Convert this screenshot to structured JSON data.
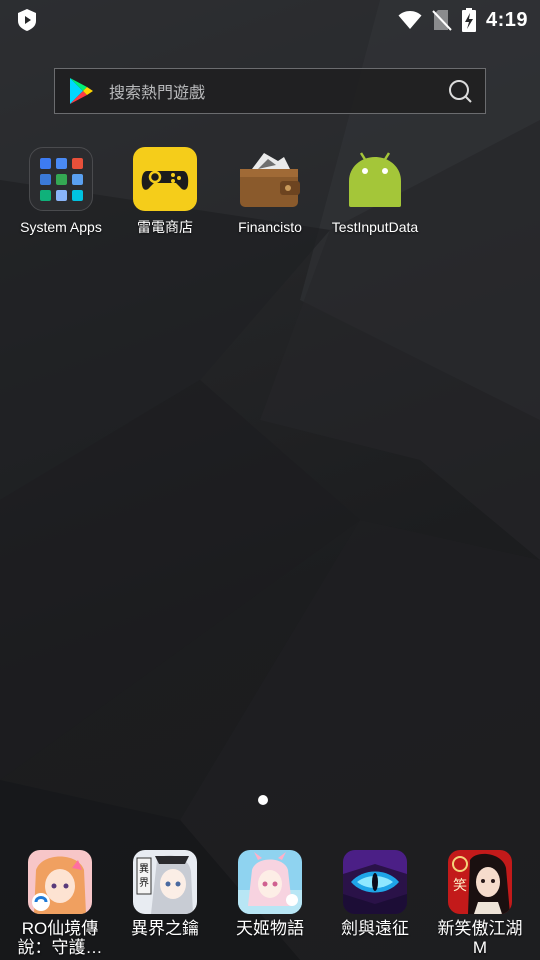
{
  "status_bar": {
    "time": "4:19",
    "left_icon": "shield-play-icon",
    "icons": [
      "wifi-icon",
      "no-sim-icon",
      "battery-charging-icon"
    ]
  },
  "search": {
    "placeholder": "搜索熱門遊戲",
    "logo": "google-play-icon",
    "button_icon": "search-icon"
  },
  "apps": [
    {
      "label": "System Apps",
      "icon": "folder-icon"
    },
    {
      "label": "雷電商店",
      "icon": "gamepad-store-icon"
    },
    {
      "label": "Financisto",
      "icon": "wallet-icon"
    },
    {
      "label": "TestInputData",
      "icon": "android-icon"
    }
  ],
  "page_indicator": {
    "pages": 1,
    "current": 1
  },
  "dock": [
    {
      "label_line1": "RO仙境傳",
      "label_line2": "說：守護…",
      "icon": "ro-game-icon"
    },
    {
      "label_line1": "異界之鑰",
      "label_line2": "",
      "icon": "anime-girl-icon"
    },
    {
      "label_line1": "天姬物語",
      "label_line2": "",
      "icon": "fantasy-girl-icon"
    },
    {
      "label_line1": "劍與遠征",
      "label_line2": "",
      "icon": "dragon-eye-icon"
    },
    {
      "label_line1": "新笑傲江湖",
      "label_line2": "M",
      "icon": "wuxia-icon"
    }
  ],
  "colors": {
    "wallpaper": "#232426",
    "store_yellow": "#f5cd1a",
    "android_green": "#a4c639"
  }
}
